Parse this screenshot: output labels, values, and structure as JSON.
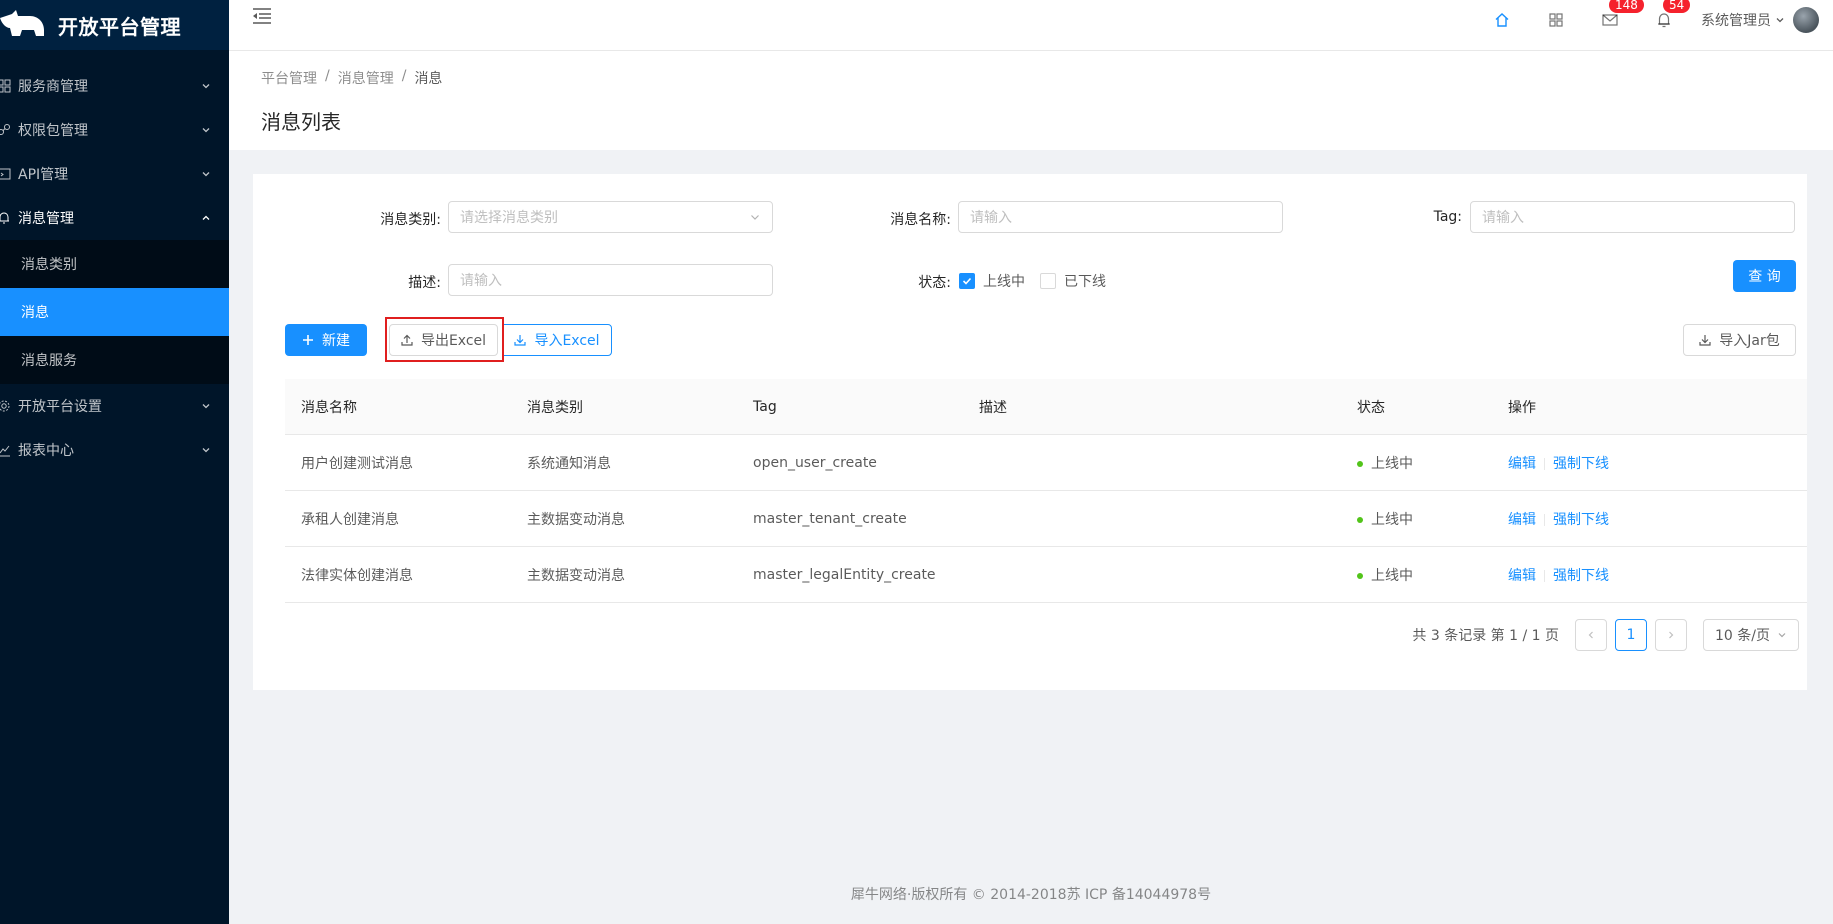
{
  "app": {
    "title": "开放平台管理"
  },
  "sidebar": {
    "items": [
      {
        "label": "服务商管理",
        "icon": "cluster-icon"
      },
      {
        "label": "权限包管理",
        "icon": "share-icon"
      },
      {
        "label": "API管理",
        "icon": "api-icon"
      },
      {
        "label": "消息管理",
        "icon": "bell-icon",
        "open": true,
        "children": [
          {
            "label": "消息类别"
          },
          {
            "label": "消息",
            "active": true
          },
          {
            "label": "消息服务"
          }
        ]
      },
      {
        "label": "开放平台设置",
        "icon": "setting-icon"
      },
      {
        "label": "报表中心",
        "icon": "chart-icon"
      }
    ]
  },
  "header": {
    "mail_count": "148",
    "notice_count": "54",
    "user_name": "系统管理员"
  },
  "breadcrumb": [
    "平台管理",
    "消息管理",
    "消息"
  ],
  "page": {
    "title": "消息列表"
  },
  "filters": {
    "category_label": "消息类别:",
    "category_placeholder": "请选择消息类别",
    "name_label": "消息名称:",
    "name_placeholder": "请输入",
    "tag_label": "Tag:",
    "tag_placeholder": "请输入",
    "desc_label": "描述:",
    "desc_placeholder": "请输入",
    "status_label": "状态:",
    "status_online": "上线中",
    "status_offline": "已下线",
    "query_button": "查 询"
  },
  "toolbar": {
    "new_button": "新建",
    "export_button": "导出Excel",
    "import_button": "导入Excel",
    "import_jar_button": "导入Jar包"
  },
  "table": {
    "columns": [
      "消息名称",
      "消息类别",
      "Tag",
      "描述",
      "状态",
      "操作"
    ],
    "rows": [
      {
        "name": "用户创建测试消息",
        "category": "系统通知消息",
        "tag": "open_user_create",
        "desc": "",
        "status": "上线中"
      },
      {
        "name": "承租人创建消息",
        "category": "主数据变动消息",
        "tag": "master_tenant_create",
        "desc": "",
        "status": "上线中"
      },
      {
        "name": "法律实体创建消息",
        "category": "主数据变动消息",
        "tag": "master_legalEntity_create",
        "desc": "",
        "status": "上线中"
      }
    ],
    "action_edit": "编辑",
    "action_offline": "强制下线"
  },
  "pagination": {
    "summary": "共 3 条记录 第 1 / 1 页",
    "current": "1",
    "page_size": "10 条/页"
  },
  "footer": {
    "text": "犀牛网络·版权所有 © 2014-2018苏 ICP 备14044978号"
  },
  "colors": {
    "primary": "#1890ff",
    "sidebar": "#001529",
    "danger": "#f5222d",
    "success": "#52c41a",
    "highlight": "#e01f1f"
  }
}
